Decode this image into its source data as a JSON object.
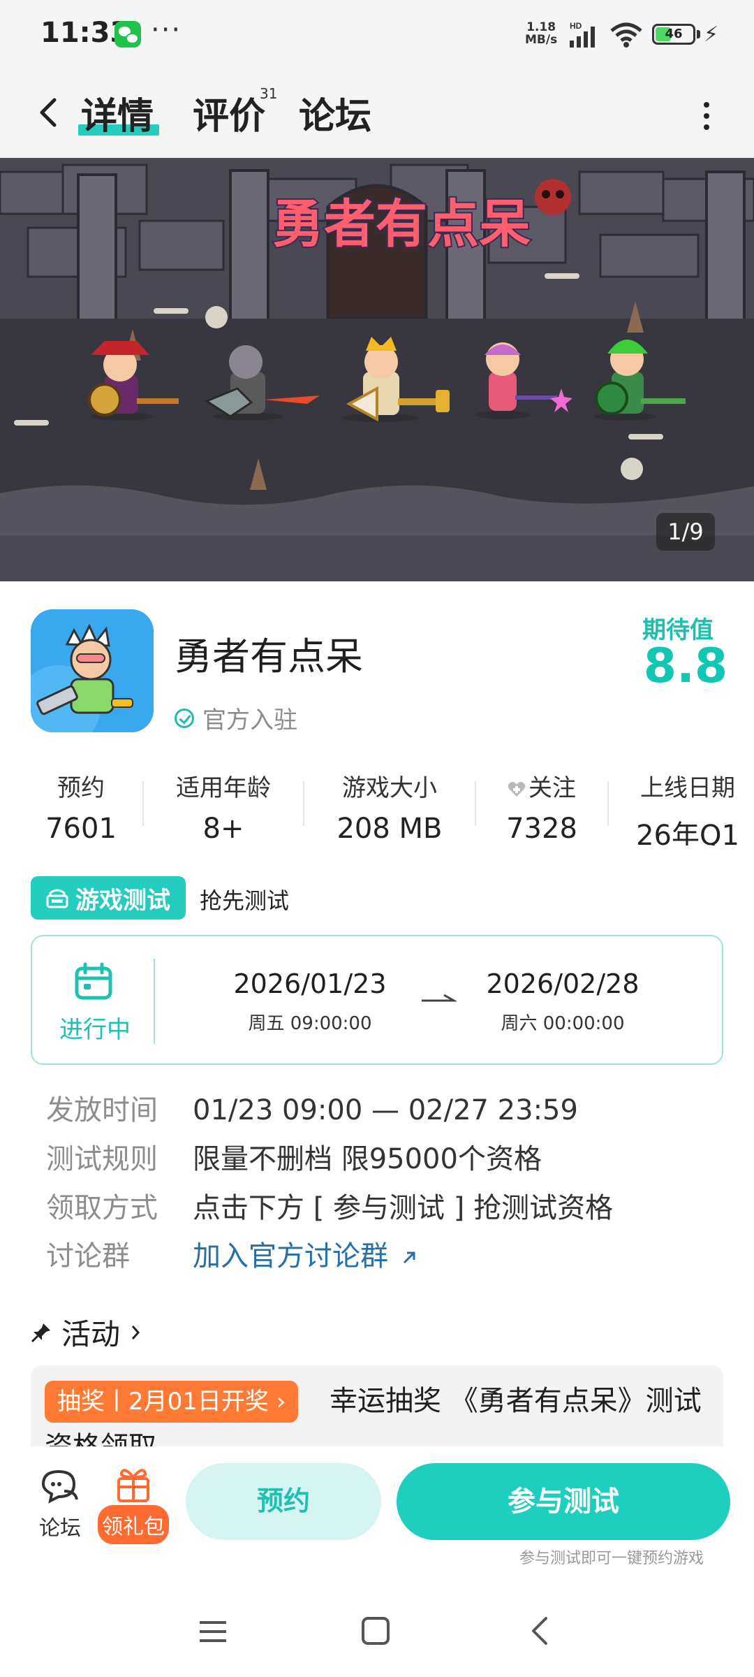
{
  "status_bar": {
    "time": "11:33",
    "net_speed_value": "1.18",
    "net_speed_unit": "MB/s",
    "network_label": "HD",
    "battery": "46",
    "battery_level": 0.46
  },
  "tabs": [
    {
      "label": "详情",
      "active": true
    },
    {
      "label": "评价",
      "count": "31"
    },
    {
      "label": "论坛"
    }
  ],
  "banner": {
    "title_art": "勇者有点呆",
    "counter": "1/9"
  },
  "game": {
    "name": "勇者有点呆",
    "official": "官方入驻",
    "expect_label": "期待值",
    "expect_value": "8.8"
  },
  "stats": [
    {
      "label": "预约",
      "value": "7601"
    },
    {
      "label": "适用年龄",
      "value": "8+"
    },
    {
      "label": "游戏大小",
      "value": "208 MB"
    },
    {
      "label": "关注",
      "value": "7328"
    },
    {
      "label": "上线日期",
      "value": "26年Q1"
    }
  ],
  "test": {
    "badge": "游戏测试",
    "type": "抢先测试",
    "status": "进行中",
    "start_date": "2026/01/23",
    "start_sub": "周五  09:00:00",
    "end_date": "2026/02/28",
    "end_sub": "周六  00:00:00"
  },
  "info": [
    {
      "label": "发放时间",
      "value": "01/23 09:00 — 02/27 23:59"
    },
    {
      "label": "测试规则",
      "value": "限量不删档 限95000个资格"
    },
    {
      "label": "领取方式",
      "value": "点击下方 [ 参与测试 ] 抢测试资格"
    },
    {
      "label": "讨论群",
      "value": "加入官方讨论群"
    }
  ],
  "activity": {
    "title": "活动",
    "badge": "抽奖丨2月01日开奖 ›",
    "text": "幸运抽奖 《勇者有点呆》测试资格领取"
  },
  "bottom": {
    "forum": "论坛",
    "gift": "领礼包",
    "reserve": "预约",
    "join": "参与测试",
    "hint": "参与测试即可一键预约游戏"
  },
  "colors": {
    "accent": "#24cdbf",
    "orange": "#ff7a35",
    "link": "#2a6fa3"
  }
}
